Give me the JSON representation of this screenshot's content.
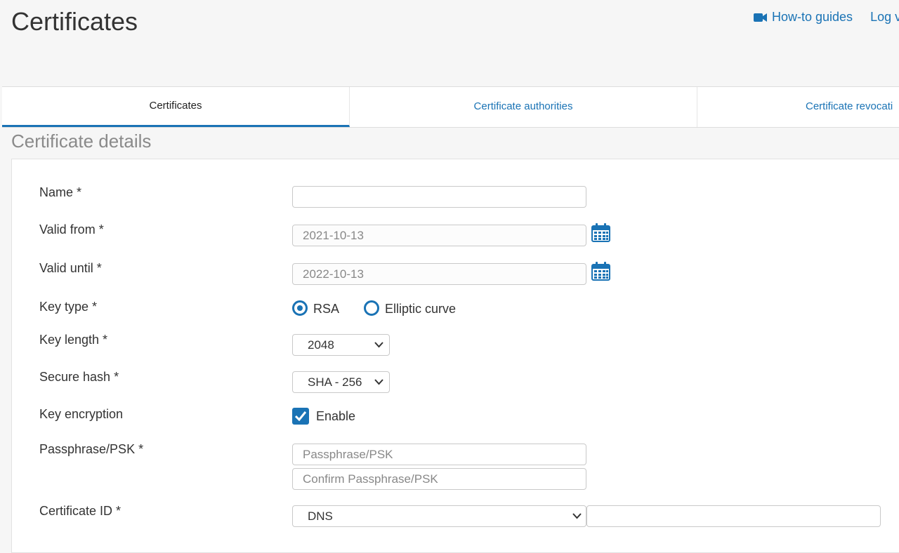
{
  "header": {
    "title": "Certificates",
    "links": [
      {
        "label": "How-to guides",
        "icon": "video-camera-icon"
      },
      {
        "label": "Log v"
      }
    ]
  },
  "tabs": [
    {
      "label": "Certificates",
      "active": true
    },
    {
      "label": "Certificate authorities",
      "active": false
    },
    {
      "label": "Certificate revocati",
      "active": false
    }
  ],
  "section": {
    "title": "Certificate details"
  },
  "form": {
    "name": {
      "label": "Name *",
      "value": ""
    },
    "valid_from": {
      "label": "Valid from *",
      "value": "2021-10-13",
      "icon": "calendar-icon"
    },
    "valid_until": {
      "label": "Valid until *",
      "value": "2022-10-13",
      "icon": "calendar-icon"
    },
    "key_type": {
      "label": "Key type *",
      "options": [
        {
          "label": "RSA",
          "selected": true
        },
        {
          "label": "Elliptic curve",
          "selected": false
        }
      ]
    },
    "key_length": {
      "label": "Key length *",
      "value": "2048"
    },
    "secure_hash": {
      "label": "Secure hash *",
      "value": "SHA - 256"
    },
    "key_encryption": {
      "label": "Key encryption",
      "checkbox_label": "Enable",
      "checked": true
    },
    "passphrase": {
      "label": "Passphrase/PSK *",
      "placeholder": "Passphrase/PSK",
      "confirm_placeholder": "Confirm Passphrase/PSK"
    },
    "certificate_id": {
      "label": "Certificate ID *",
      "type_value": "DNS",
      "value": ""
    }
  },
  "colors": {
    "accent": "#1a73b5",
    "background": "#f6f6f6"
  }
}
